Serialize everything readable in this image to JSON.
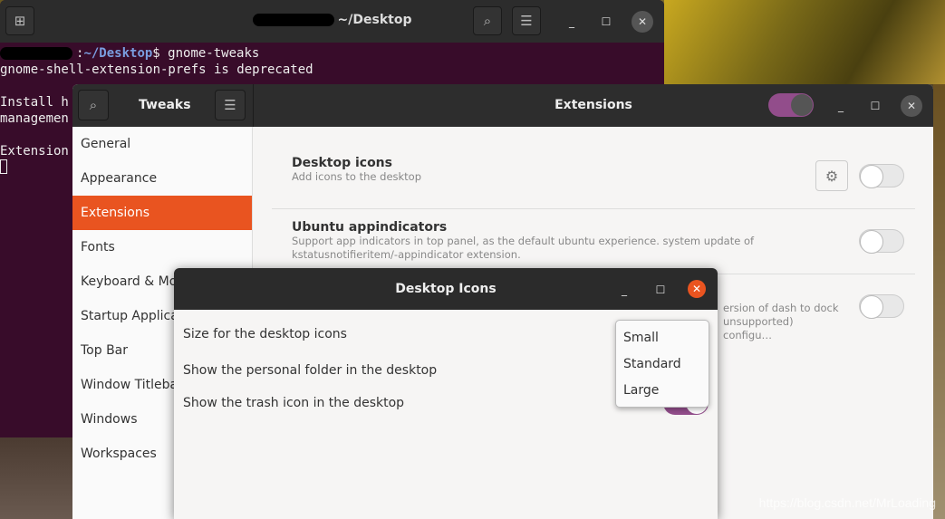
{
  "terminal": {
    "title": "~/Desktop",
    "prompt_path": "~/Desktop",
    "command": "gnome-tweaks",
    "lines": [
      "gnome-shell-extension-prefs is deprecated",
      "",
      "Install h",
      "managemen",
      "",
      "Extension"
    ]
  },
  "tweaks": {
    "title": "Tweaks",
    "section_title": "Extensions",
    "extensions_enabled": true,
    "sidebar": [
      "General",
      "Appearance",
      "Extensions",
      "Fonts",
      "Keyboard & Mouse",
      "Startup Applications",
      "Top Bar",
      "Window Titlebars",
      "Windows",
      "Workspaces"
    ],
    "selected": "Extensions",
    "extensions": [
      {
        "name": "Desktop icons",
        "desc": "Add icons to the desktop",
        "enabled": false
      },
      {
        "name": "Ubuntu appindicators",
        "desc": "Support app indicators in top panel, as the default ubuntu experience. system update of kstatusnotifieritem/-appindicator extension.",
        "enabled": false
      },
      {
        "name": "",
        "desc": "ersion of dash to dock unsupported) configu…",
        "enabled": false
      }
    ]
  },
  "dialog": {
    "title": "Desktop Icons",
    "options": [
      "Size for the desktop icons",
      "Show the personal folder in the desktop",
      "Show the trash icon in the desktop"
    ],
    "trash_enabled": true,
    "size_menu": [
      "Small",
      "Standard",
      "Large"
    ]
  },
  "watermark": "https://blog.csdn.net/MrLoading",
  "colors": {
    "accent": "#e95420",
    "toggle_on": "#924d8b",
    "terminal_bg": "#380c2a"
  }
}
